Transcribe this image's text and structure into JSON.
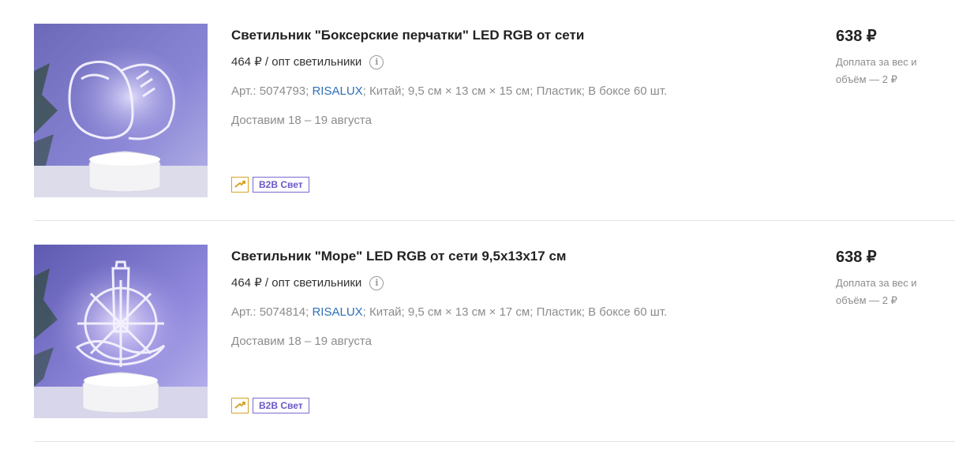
{
  "products": [
    {
      "title": "Светильник \"Боксерские перчатки\" LED RGB от сети",
      "opt_price": "464 ₽ / опт светильники",
      "info_icon": "info-icon",
      "article": "Арт.: 5074793;",
      "brand": "RISALUX",
      "specs_rest": "; Китай; 9,5 см × 13 см × 15 см; Пластик; В боксе 60 шт.",
      "delivery": "Доставим 18 – 19 августа",
      "badge_label": "B2B Свет",
      "price": "638 ₽",
      "surcharge": "Доплата за вес и объём — 2 ₽"
    },
    {
      "title": "Светильник \"Море\" LED RGB от сети 9,5х13х17 см",
      "opt_price": "464 ₽ / опт светильники",
      "info_icon": "info-icon",
      "article": "Арт.: 5074814;",
      "brand": "RISALUX",
      "specs_rest": "; Китай; 9,5 см × 13 см × 17 см; Пластик; В боксе 60 шт.",
      "delivery": "Доставим 18 – 19 августа",
      "badge_label": "B2B Свет",
      "price": "638 ₽",
      "surcharge": "Доплата за вес и объём — 2 ₽"
    }
  ],
  "colors": {
    "brand_link": "#2d6fb8",
    "badge_purple": "#6b57c9",
    "badge_gold": "#d9a227",
    "muted_text": "#8c8c8c"
  }
}
